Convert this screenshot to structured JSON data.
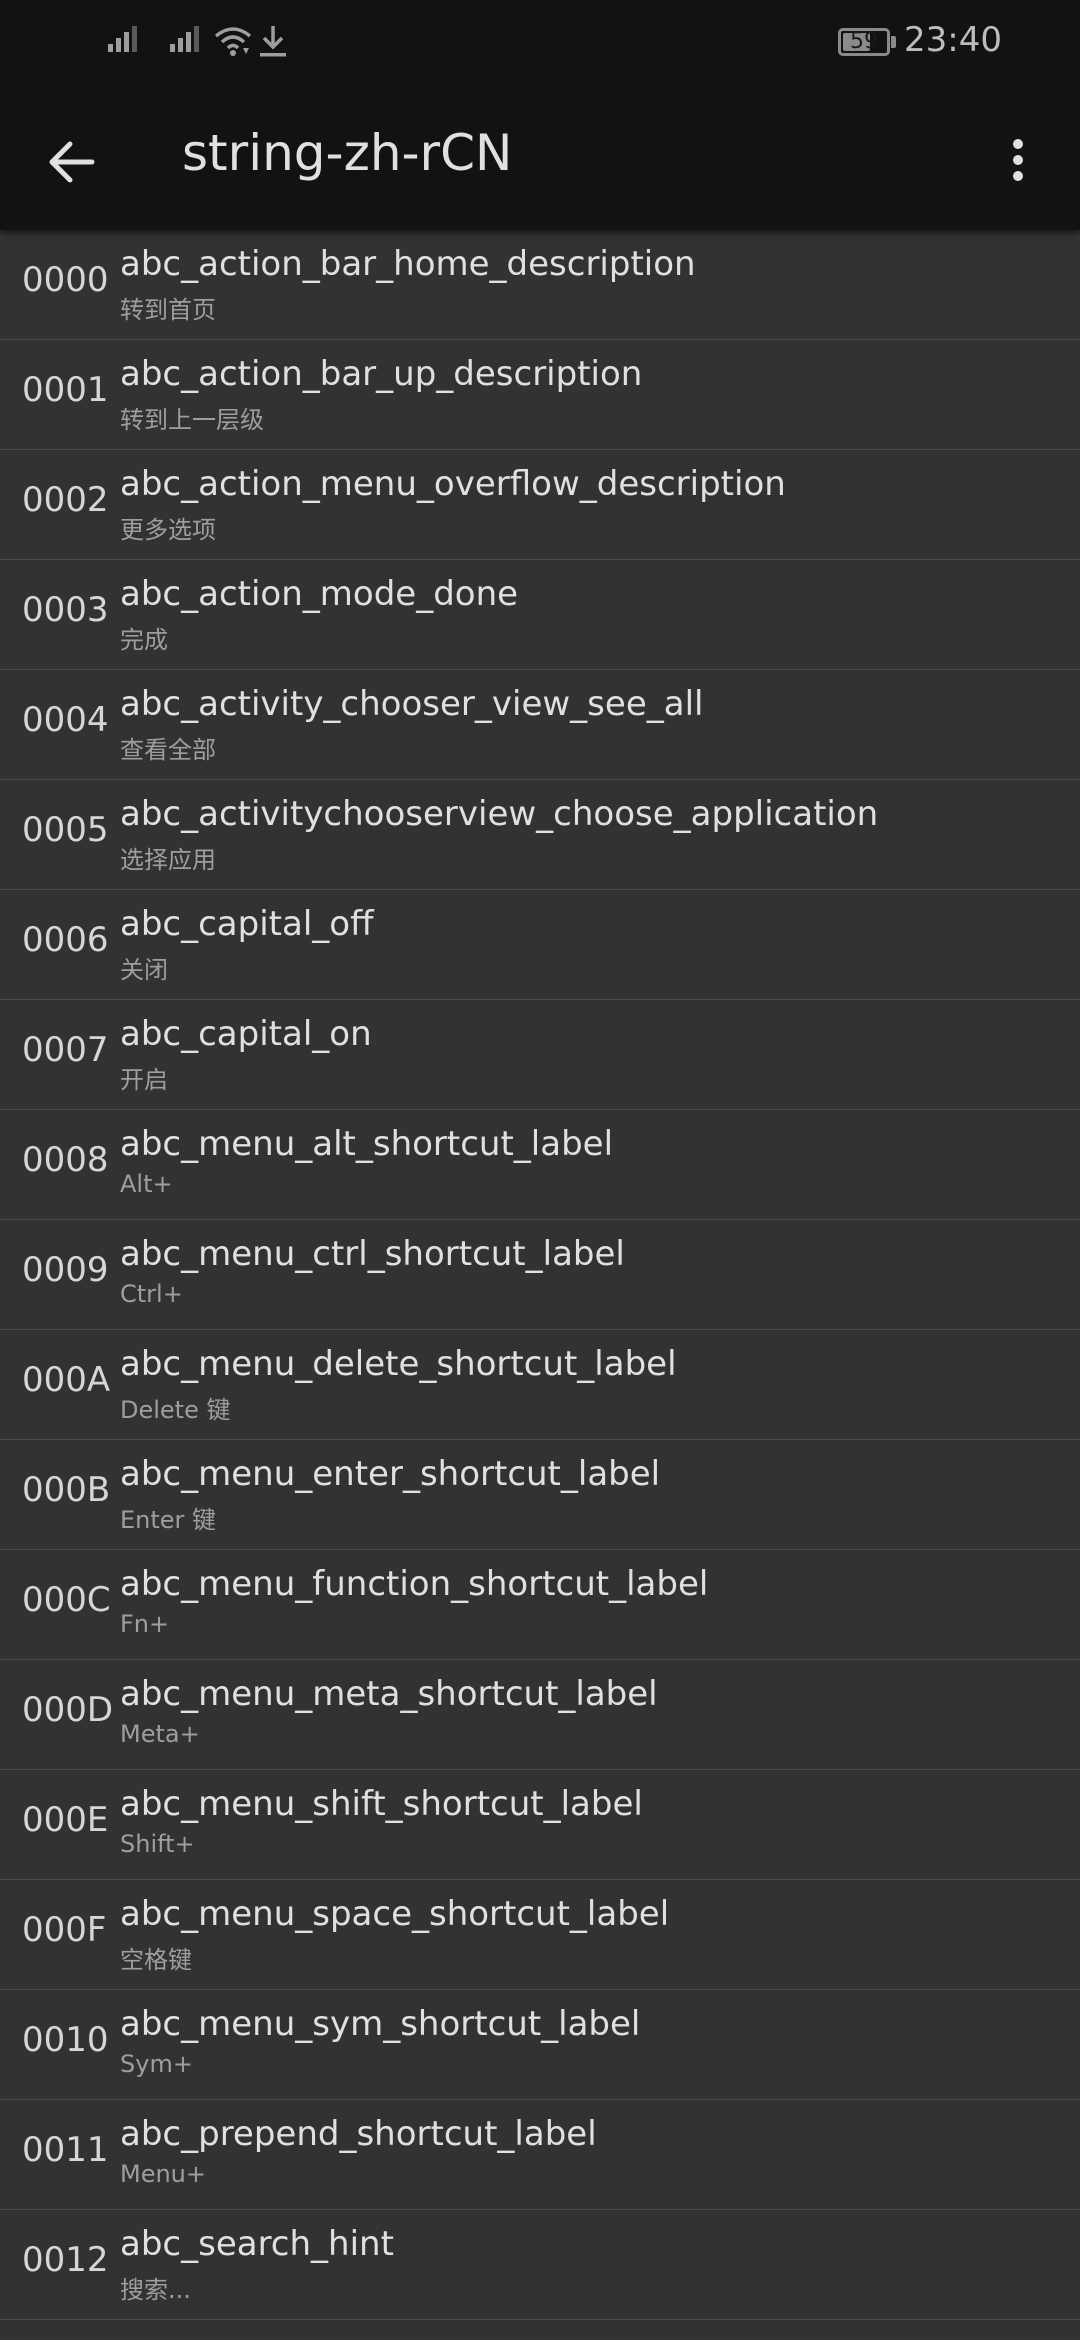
{
  "status_bar": {
    "battery_level": "59",
    "time": "23:40",
    "icons": [
      "signal-icon",
      "signal-icon",
      "wifi-icon",
      "download-icon",
      "battery-icon"
    ]
  },
  "app_bar": {
    "title": "string-zh-rCN",
    "back_icon": "arrow-back-icon",
    "more_icon": "more-vert-icon"
  },
  "entries": [
    {
      "id": "0000",
      "name": "abc_action_bar_home_description",
      "value": "转到首页"
    },
    {
      "id": "0001",
      "name": "abc_action_bar_up_description",
      "value": "转到上一层级"
    },
    {
      "id": "0002",
      "name": "abc_action_menu_overflow_description",
      "value": "更多选项"
    },
    {
      "id": "0003",
      "name": "abc_action_mode_done",
      "value": "完成"
    },
    {
      "id": "0004",
      "name": "abc_activity_chooser_view_see_all",
      "value": "查看全部"
    },
    {
      "id": "0005",
      "name": "abc_activitychooserview_choose_application",
      "value": "选择应用"
    },
    {
      "id": "0006",
      "name": "abc_capital_off",
      "value": "关闭"
    },
    {
      "id": "0007",
      "name": "abc_capital_on",
      "value": "开启"
    },
    {
      "id": "0008",
      "name": "abc_menu_alt_shortcut_label",
      "value": "Alt+"
    },
    {
      "id": "0009",
      "name": "abc_menu_ctrl_shortcut_label",
      "value": "Ctrl+"
    },
    {
      "id": "000A",
      "name": "abc_menu_delete_shortcut_label",
      "value": "Delete 键"
    },
    {
      "id": "000B",
      "name": "abc_menu_enter_shortcut_label",
      "value": "Enter 键"
    },
    {
      "id": "000C",
      "name": "abc_menu_function_shortcut_label",
      "value": "Fn+"
    },
    {
      "id": "000D",
      "name": "abc_menu_meta_shortcut_label",
      "value": "Meta+"
    },
    {
      "id": "000E",
      "name": "abc_menu_shift_shortcut_label",
      "value": "Shift+"
    },
    {
      "id": "000F",
      "name": "abc_menu_space_shortcut_label",
      "value": "空格键"
    },
    {
      "id": "0010",
      "name": "abc_menu_sym_shortcut_label",
      "value": "Sym+"
    },
    {
      "id": "0011",
      "name": "abc_prepend_shortcut_label",
      "value": "Menu+"
    },
    {
      "id": "0012",
      "name": "abc_search_hint",
      "value": "搜索..."
    }
  ]
}
